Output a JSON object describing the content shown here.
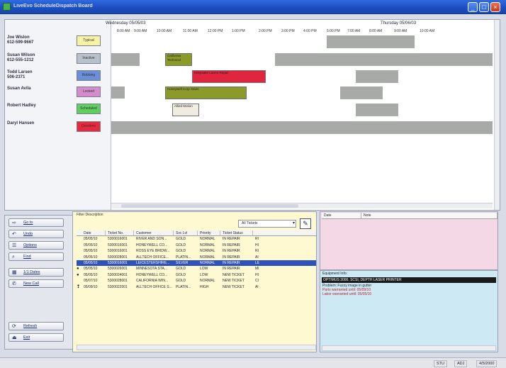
{
  "window": {
    "title": "LiveEvo ScheduleDispatch Board",
    "controls": {
      "minimize": "_",
      "maximize": "□",
      "close": "×"
    }
  },
  "schedule": {
    "day_headers": [
      "Wednesday 05/05/03",
      "Thursday 05/06/03"
    ],
    "time_labels": [
      "8:00 AM",
      "9:00 AM",
      "10:00 AM",
      "11:00 AM",
      "12:00 PM",
      "1:00 PM",
      "2:00 PM",
      "3:00 PM",
      "4:00 PM",
      "5:00 PM",
      "7:00 AM",
      "8:00 AM",
      "9:00 AM",
      "10:00 AM"
    ],
    "technicians": [
      {
        "name": "Joe Wislon",
        "phone": "612-599-9667",
        "badge": "Typical",
        "color": "#f6f3a4"
      },
      {
        "name": "Susan Wilson",
        "phone": "612-555-1212",
        "badge": "Inactive",
        "color": "#b8c0cc"
      },
      {
        "name": "Todd Larsen",
        "phone": "506-2371",
        "badge": "Bobbing",
        "color": "#6a8fd8"
      },
      {
        "name": "Susan Avila",
        "phone": "",
        "badge": "Locked",
        "color": "#d48ccc"
      },
      {
        "name": "Robert Hadley",
        "phone": "",
        "badge": "Scheduled",
        "color": "#5fd05f"
      },
      {
        "name": "Daryl Hansen",
        "phone": "",
        "badge": "Overtime",
        "color": "#e8283c"
      }
    ],
    "appointments": [
      {
        "lane": 1,
        "label": "California Technical",
        "color": "#8c9a2a"
      },
      {
        "lane": 2,
        "label": "Keepsake Lawns Repair",
        "color": "#e0263e"
      },
      {
        "lane": 3,
        "label": "Honeywell Corp Stairs",
        "color": "#8c9a2a"
      },
      {
        "lane": 4,
        "label": "Allied Motion",
        "color": "#f0ece0"
      }
    ]
  },
  "toolbar": {
    "buttons": [
      {
        "label": "Go to",
        "icon": "goto-icon",
        "glyph": "⇨"
      },
      {
        "label": "Undo",
        "icon": "undo-icon",
        "glyph": "↶"
      },
      {
        "label": "Options",
        "icon": "options-icon",
        "glyph": "☰"
      },
      {
        "label": "Find",
        "icon": "find-icon",
        "glyph": "⌕"
      },
      {
        "label": "1/1 Dates",
        "icon": "dates-icon",
        "glyph": "▦"
      },
      {
        "label": "New Call",
        "icon": "new-call-icon",
        "glyph": "✆"
      },
      {
        "label": "Refresh",
        "icon": "refresh-icon",
        "glyph": "⟳"
      },
      {
        "label": "Exit",
        "icon": "exit-icon",
        "glyph": "⏏"
      }
    ]
  },
  "tickets": {
    "description_label": "Filter Description",
    "filter_value": "All Tickets",
    "columns": [
      "Date",
      "Ticket No.",
      "Customer",
      "Svc Lvl",
      "Priority",
      "Ticket Status",
      ""
    ],
    "rows": [
      {
        "icon": "",
        "date": "05/05/10",
        "ticket": "5300016001",
        "customer": "RIVER AND SON...",
        "svc": "GOLD",
        "priority": "NORMAL",
        "status": "IN REPAIR",
        "extra": "RI",
        "selected": false
      },
      {
        "icon": "",
        "date": "05/05/10",
        "ticket": "5300016001",
        "customer": "HONEYWELL CO...",
        "svc": "GOLD",
        "priority": "NORMAL",
        "status": "IN REPAIR",
        "extra": "HI",
        "selected": false
      },
      {
        "icon": "",
        "date": "05/05/10",
        "ticket": "5300016001",
        "customer": "ROSS EYE BRIDW...",
        "svc": "GOLD",
        "priority": "NORMAL",
        "status": "IN REPAIR",
        "extra": "RI",
        "selected": false
      },
      {
        "icon": "",
        "date": "05/05/10",
        "ticket": "5300028001",
        "customer": "ALLTECH OFFICE...",
        "svc": "PLATIN...",
        "priority": "NORMAL",
        "status": "IN REPAIR",
        "extra": "AI",
        "selected": false
      },
      {
        "icon": "",
        "date": "05/05/10",
        "ticket": "5300016001",
        "customer": "LEICESTERSHIRE...",
        "svc": "SILVER",
        "priority": "NORMAL",
        "status": "IN REPAIR",
        "extra": "LE",
        "selected": true
      },
      {
        "icon": "●",
        "date": "05/05/10",
        "ticket": "5300026001",
        "customer": "MINNESOTA STA...",
        "svc": "GOLD",
        "priority": "LOW",
        "status": "IN REPAIR",
        "extra": "MI",
        "selected": false
      },
      {
        "icon": "●",
        "date": "05/05/10",
        "ticket": "5300024001",
        "customer": "HONEYWELL CO...",
        "svc": "GOLD",
        "priority": "LOW",
        "status": "NEW TICKET",
        "extra": "HI",
        "selected": false
      },
      {
        "icon": "",
        "date": "05/07/10",
        "ticket": "5300028001",
        "customer": "CALIFORNIA WIN...",
        "svc": "GOLD",
        "priority": "NORMAL",
        "status": "NEW TICKET",
        "extra": "CI",
        "selected": false
      },
      {
        "icon": "❢",
        "date": "05/09/10",
        "ticket": "5300022001",
        "customer": "ALLTECH OFFICE S...",
        "svc": "PLATIN...",
        "priority": "HIGH",
        "status": "NEW TICKET",
        "extra": "Al",
        "selected": false
      }
    ]
  },
  "notes": {
    "columns": [
      "Date",
      "Note"
    ]
  },
  "equipment": {
    "label": "Equipment Info:",
    "selected": "OPTIMUS 3000. SCSI, DEPTH LASER PRINTER",
    "lines": [
      {
        "text": "Problem: Fuzzy image in gutter",
        "color": "#1d2230"
      },
      {
        "text": "Parts warranted until: 05/09/10",
        "color": "#c0202a"
      },
      {
        "text": "Labor warranted until: 05/05/10",
        "color": "#c0202a"
      }
    ]
  },
  "status": {
    "cells": [
      "STU",
      "ADJ",
      "4/5/2000"
    ]
  }
}
